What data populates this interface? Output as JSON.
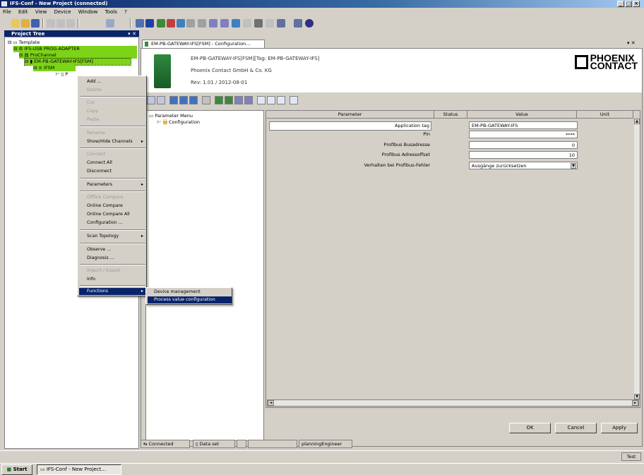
{
  "window": {
    "title": "IFS-Conf - New Project (connected)"
  },
  "menu": [
    "File",
    "Edit",
    "View",
    "Device",
    "Window",
    "Tools",
    "?"
  ],
  "project_tree": {
    "header": "Project Tree",
    "items": [
      {
        "label": "Template"
      },
      {
        "label": "IFS-USB PROG-ADAPTER"
      },
      {
        "label": "ProChannel"
      },
      {
        "label": "EM-PB-GATEWAY-IFS[FSM]"
      },
      {
        "label": "IFSM"
      },
      {
        "label": "P"
      }
    ]
  },
  "context_menu": {
    "items": [
      {
        "label": "Add ...",
        "disabled": false
      },
      {
        "label": "Delete",
        "disabled": true
      },
      {
        "label": "Cut",
        "disabled": true
      },
      {
        "label": "Copy",
        "disabled": true
      },
      {
        "label": "Paste",
        "disabled": true
      },
      {
        "label": "Rename",
        "disabled": true
      },
      {
        "label": "Show/Hide Channels",
        "disabled": false,
        "submenu": true
      },
      {
        "label": "Connect",
        "disabled": true
      },
      {
        "label": "Connect All",
        "disabled": false
      },
      {
        "label": "Disconnect",
        "disabled": false
      },
      {
        "label": "Parameters",
        "disabled": false,
        "submenu": true
      },
      {
        "label": "Offline Compare",
        "disabled": true
      },
      {
        "label": "Online Compare",
        "disabled": false
      },
      {
        "label": "Online Compare All",
        "disabled": false
      },
      {
        "label": "Configuration ...",
        "disabled": false
      },
      {
        "label": "Scan Topology",
        "disabled": false,
        "submenu": true
      },
      {
        "label": "Observe ...",
        "disabled": false
      },
      {
        "label": "Diagnosis ...",
        "disabled": false
      },
      {
        "label": "Import / Export",
        "disabled": true
      },
      {
        "label": "Info",
        "disabled": false
      },
      {
        "label": "Functions",
        "disabled": false,
        "submenu": true,
        "selected": true
      }
    ],
    "submenu_items": [
      "Device management",
      "Process value configuration"
    ]
  },
  "document": {
    "tab_label": "EM-PB-GATEWAY-IFS[FSM] - Configuration...",
    "device_name": "EM-PB-GATEWAY-IFS[FSM][Tag: EM-PB-GATEWAY-IFS]",
    "vendor": "Phoenix Contact GmbH & Co. KG",
    "revision": "Rev: 1.01 / 2012-08-01",
    "logo_line1": "PHOENIX",
    "logo_line2": "CONTACT"
  },
  "parameter_nav": {
    "root": "Parameter Menu",
    "child": "Configuration"
  },
  "parameter_table": {
    "headers": [
      "Parameter",
      "Status",
      "Value",
      "Unit"
    ],
    "rows": [
      {
        "parameter": "Application tag",
        "value": "EM-PB-GATEWAY-IFS"
      },
      {
        "parameter": "Pin",
        "value": "****"
      },
      {
        "parameter": "Profibus Busadresse",
        "value": "0"
      },
      {
        "parameter": "Profibus Adressoffset",
        "value": "10"
      },
      {
        "parameter": "Verhalten bei Profibus-Fehler",
        "value": "Ausgänge zurücksetzen"
      }
    ]
  },
  "buttons": {
    "ok": "OK",
    "cancel": "Cancel",
    "apply": "Apply"
  },
  "status": {
    "connection": "Connected",
    "dataset": "Data set",
    "user": "planningEngineer"
  },
  "bottom": {
    "test": "Test"
  },
  "taskbar": {
    "start": "Start",
    "task": "IFS-Conf - New Project..."
  },
  "colors": {
    "tree_highlight": "#7cd317",
    "menu_selected": "#0a246a",
    "titlebar": "#0a246a"
  }
}
